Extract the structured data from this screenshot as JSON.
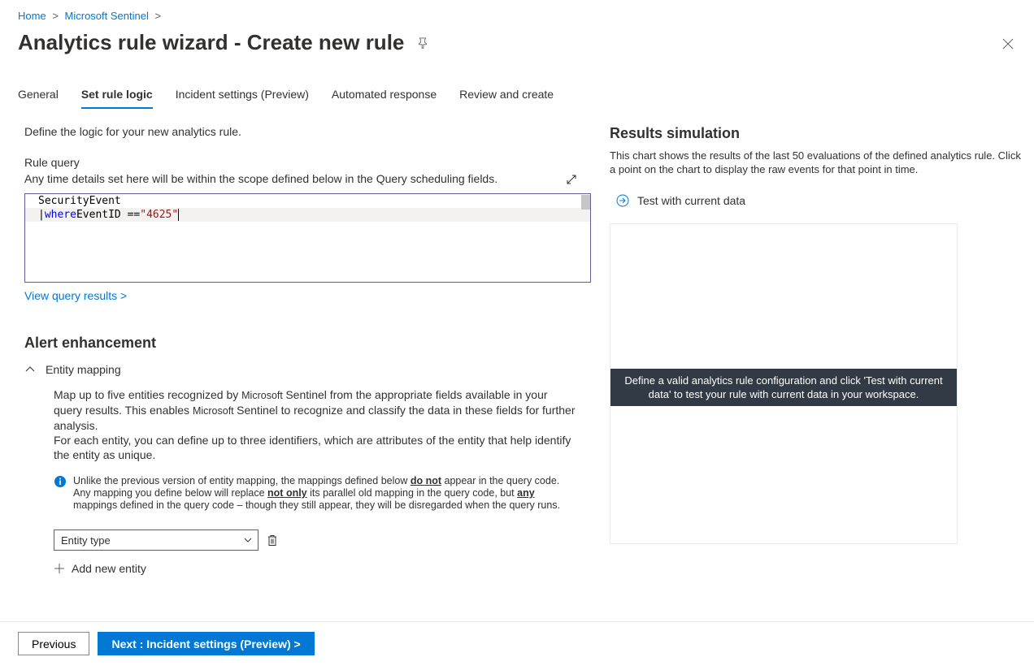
{
  "breadcrumb": {
    "home": "Home",
    "sentinel": "Microsoft Sentinel"
  },
  "page_title": "Analytics rule wizard - Create new rule",
  "tabs": [
    "General",
    "Set rule logic",
    "Incident settings (Preview)",
    "Automated response",
    "Review and create"
  ],
  "active_tab_index": 1,
  "intro": "Define the logic for your new analytics rule.",
  "rule_query": {
    "label": "Rule query",
    "help": "Any time details set here will be within the scope defined below in the Query scheduling fields.",
    "code_tokens": {
      "l1": "SecurityEvent",
      "l2_pipe": "| ",
      "l2_kw": "where",
      "l2_mid": " EventID == ",
      "l2_str": "\"4625\""
    },
    "view_link": "View query results >"
  },
  "alert_enhancement": {
    "title": "Alert enhancement",
    "entity_mapping": {
      "heading": "Entity mapping",
      "desc_pre": "Map up to five entities recognized by ",
      "desc_ms": "Microsoft ",
      "desc_mid1": "Sentinel from the appropriate fields available in your query results. This enables ",
      "desc_ms2": "Microsoft ",
      "desc_post": "Sentinel to recognize and classify the data in these fields for further analysis.\nFor each entity, you can define up to three identifiers, which are attributes of the entity that help identify the entity as unique.",
      "info_pre": "Unlike the previous version of entity mapping, the mappings defined below ",
      "info_u1": "do not",
      "info_mid1": " appear in the query code. Any mapping you define below will replace ",
      "info_u2": "not only",
      "info_mid2": " its parallel old mapping in the query code, but ",
      "info_u3": "any",
      "info_post": " mappings defined in the query code – though they still appear, they will be disregarded when the query runs.",
      "select_placeholder": "Entity type",
      "add_label": "Add new entity"
    }
  },
  "results_sim": {
    "title": "Results simulation",
    "desc": "This chart shows the results of the last 50 evaluations of the defined analytics rule. Click a point on the chart to display the raw events for that point in time.",
    "test_label": "Test with current data",
    "overlay": "Define a valid analytics rule configuration and click 'Test with current data' to test your rule with current data in your workspace."
  },
  "footer": {
    "prev": "Previous",
    "next": "Next : Incident settings (Preview) >"
  }
}
